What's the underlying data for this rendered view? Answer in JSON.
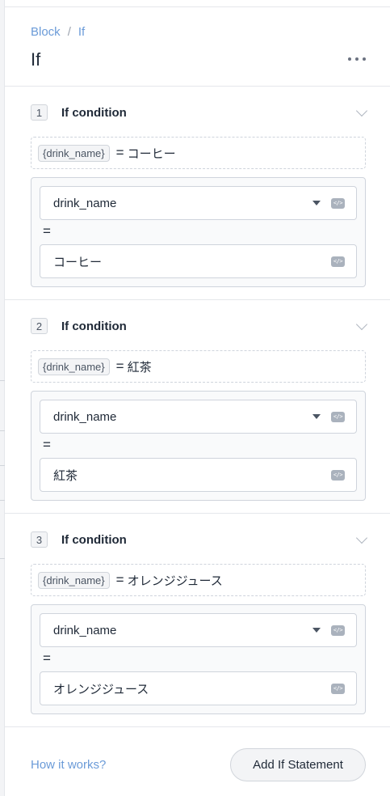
{
  "breadcrumb": {
    "parent": "Block",
    "separator": "/",
    "current": "If"
  },
  "header": {
    "title": "If"
  },
  "conditions": [
    {
      "number": "1",
      "title": "If condition",
      "variable": "{drink_name}",
      "operator": "=",
      "value": "コーヒー",
      "select_value": "drink_name"
    },
    {
      "number": "2",
      "title": "If condition",
      "variable": "{drink_name}",
      "operator": "=",
      "value": "紅茶",
      "select_value": "drink_name"
    },
    {
      "number": "3",
      "title": "If condition",
      "variable": "{drink_name}",
      "operator": "=",
      "value": "オレンジジュース",
      "select_value": "drink_name"
    }
  ],
  "footer": {
    "help_link": "How it works?",
    "add_button": "Add If Statement"
  }
}
